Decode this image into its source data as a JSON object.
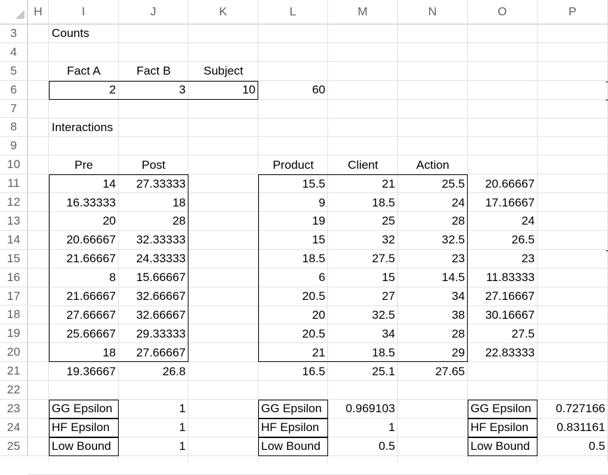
{
  "columns": [
    "H",
    "I",
    "J",
    "K",
    "L",
    "M",
    "N",
    "O",
    "P"
  ],
  "rows": [
    "3",
    "4",
    "5",
    "6",
    "7",
    "8",
    "9",
    "10",
    "11",
    "12",
    "13",
    "14",
    "15",
    "16",
    "17",
    "18",
    "19",
    "20",
    "21",
    "22",
    "23",
    "24",
    "25"
  ],
  "cells": {
    "I3": "Counts",
    "I5": "Fact A",
    "J5": "Fact B",
    "K5": "Subject",
    "I6": "2",
    "J6": "3",
    "K6": "10",
    "L6": "60",
    "I8": "Interactions",
    "I10": "Pre",
    "J10": "Post",
    "L10": "Product",
    "M10": "Client",
    "N10": "Action",
    "I11": "14",
    "J11": "27.33333",
    "L11": "15.5",
    "M11": "21",
    "N11": "25.5",
    "O11": "20.66667",
    "I12": "16.33333",
    "J12": "18",
    "L12": "9",
    "M12": "18.5",
    "N12": "24",
    "O12": "17.16667",
    "I13": "20",
    "J13": "28",
    "L13": "19",
    "M13": "25",
    "N13": "28",
    "O13": "24",
    "I14": "20.66667",
    "J14": "32.33333",
    "L14": "15",
    "M14": "32",
    "N14": "32.5",
    "O14": "26.5",
    "I15": "21.66667",
    "J15": "24.33333",
    "L15": "18.5",
    "M15": "27.5",
    "N15": "23",
    "O15": "23",
    "I16": "8",
    "J16": "15.66667",
    "L16": "6",
    "M16": "15",
    "N16": "14.5",
    "O16": "11.83333",
    "I17": "21.66667",
    "J17": "32.66667",
    "L17": "20.5",
    "M17": "27",
    "N17": "34",
    "O17": "27.16667",
    "I18": "27.66667",
    "J18": "32.66667",
    "L18": "20",
    "M18": "32.5",
    "N18": "38",
    "O18": "30.16667",
    "I19": "25.66667",
    "J19": "29.33333",
    "L19": "20.5",
    "M19": "34",
    "N19": "28",
    "O19": "27.5",
    "I20": "18",
    "J20": "27.66667",
    "L20": "21",
    "M20": "18.5",
    "N20": "29",
    "O20": "22.83333",
    "I21": "19.36667",
    "J21": "26.8",
    "L21": "16.5",
    "M21": "25.1",
    "N21": "27.65",
    "I23": "GG Epsilon",
    "J23": "1",
    "L23": "GG Epsilon",
    "M23": "0.969103",
    "O23": "GG Epsilon",
    "P23": "0.727166",
    "I24": "HF Epsilon",
    "J24": "1",
    "L24": "HF Epsilon",
    "M24": "1",
    "O24": "HF Epsilon",
    "P24": "0.831161",
    "I25": "Low Bound",
    "J25": "1",
    "L25": "Low Bound",
    "M25": "0.5",
    "O25": "Low Bound",
    "P25": "0.5"
  },
  "colors": {
    "gridline": "#e1e1e1",
    "header_text": "#5f5f5f",
    "border": "#000000"
  }
}
